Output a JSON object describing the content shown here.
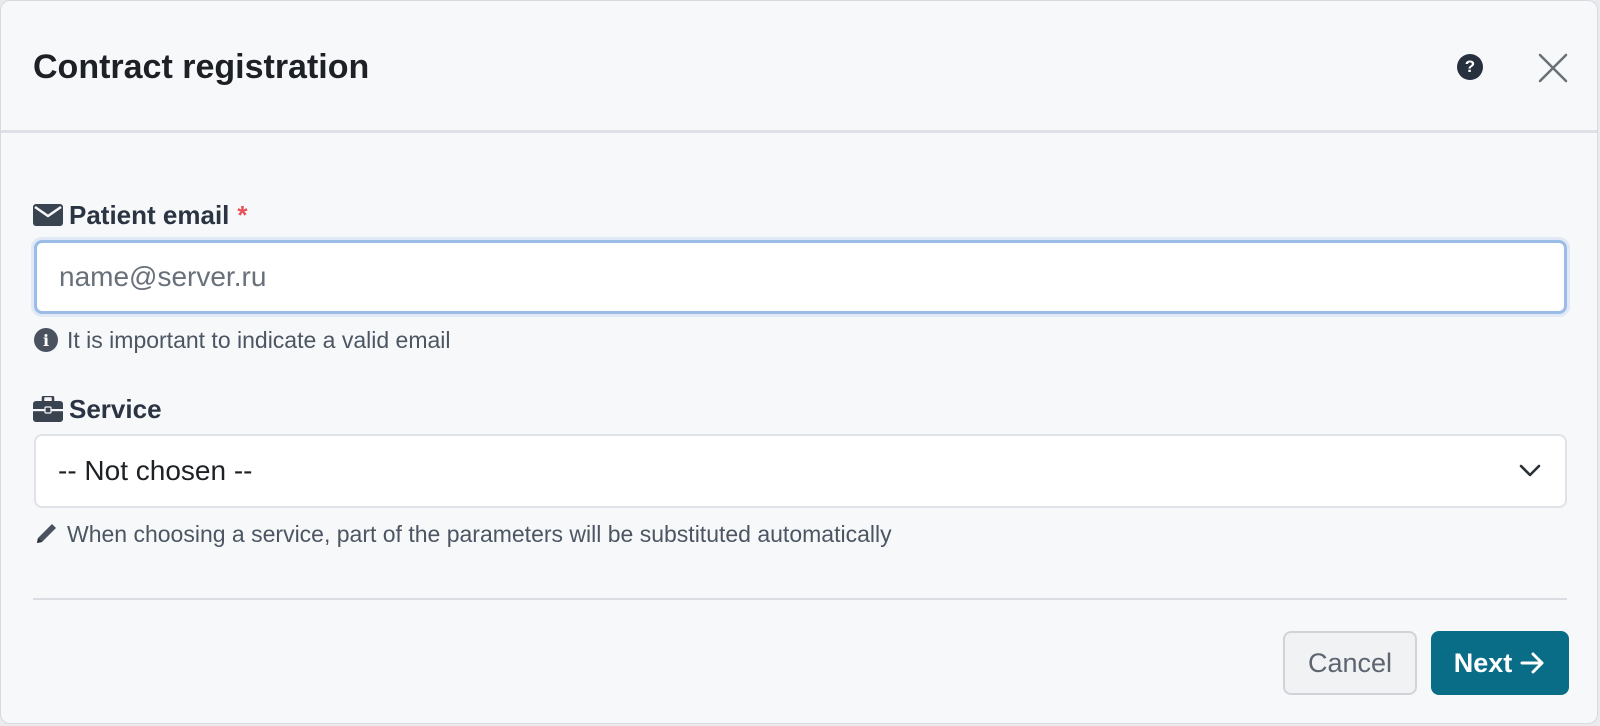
{
  "modal": {
    "title": "Contract registration",
    "help_glyph": "?",
    "help_icon": "question-circle-icon",
    "close_icon": "close-icon"
  },
  "email_field": {
    "label": "Patient email",
    "required_mark": "*",
    "icon": "envelope-icon",
    "value": "",
    "placeholder": "name@server.ru",
    "hint": "It is important to indicate a valid email",
    "hint_icon": "info-circle-icon"
  },
  "service_field": {
    "label": "Service",
    "icon": "briefcase-icon",
    "selected": "-- Not chosen --",
    "hint": "When choosing a service, part of the parameters will be substituted automatically",
    "hint_icon": "pencil-icon"
  },
  "buttons": {
    "cancel": "Cancel",
    "next": "Next"
  },
  "colors": {
    "primary": "#0a6d87",
    "required": "#e4535a",
    "focus_border": "#9cbce8"
  }
}
